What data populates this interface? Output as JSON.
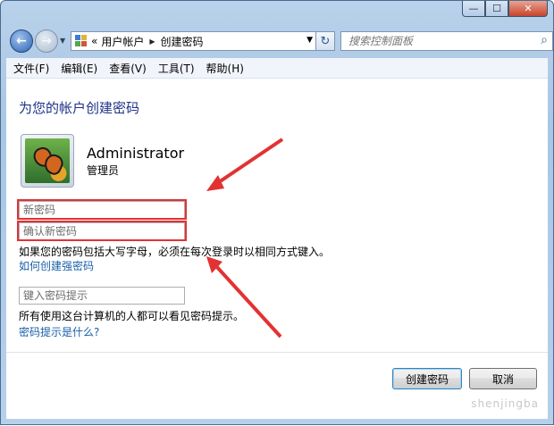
{
  "window": {
    "minimize_glyph": "—",
    "maximize_glyph": "☐",
    "close_glyph": "✕"
  },
  "navigation": {
    "address": {
      "overflow": "«",
      "crumbs": [
        "用户帐户",
        "创建密码"
      ]
    },
    "search_placeholder": "搜索控制面板"
  },
  "menu": [
    "文件(F)",
    "编辑(E)",
    "查看(V)",
    "工具(T)",
    "帮助(H)"
  ],
  "page": {
    "title": "为您的帐户创建密码",
    "user": {
      "name": "Administrator",
      "role": "管理员"
    },
    "new_password_placeholder": "新密码",
    "confirm_password_placeholder": "确认新密码",
    "case_note": "如果您的密码包括大写字母，必须在每次登录时以相同方式键入。",
    "strong_password_link": "如何创建强密码",
    "hint_placeholder": "键入密码提示",
    "hint_note": "所有使用这台计算机的人都可以看见密码提示。",
    "hint_link": "密码提示是什么?"
  },
  "buttons": {
    "create": "创建密码",
    "cancel": "取消"
  },
  "annotation_color": "#e33232",
  "watermark": "shenjingba"
}
